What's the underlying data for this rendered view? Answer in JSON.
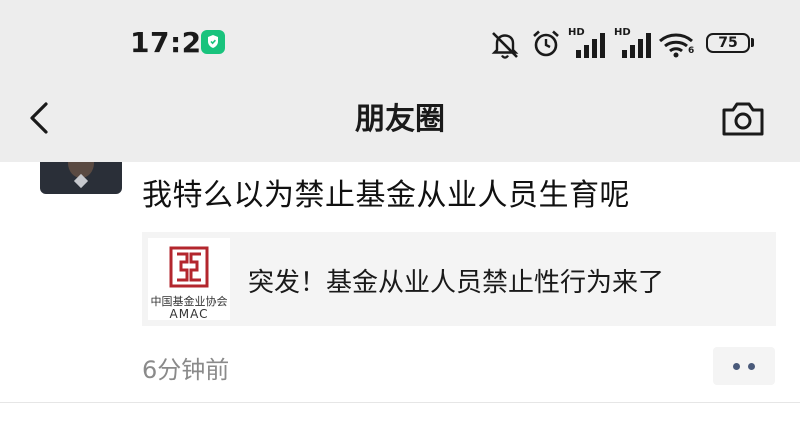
{
  "status_bar": {
    "time": "17:21",
    "battery": "75",
    "signal_label_1": "HD",
    "signal_label_2": "HD",
    "wifi_label": "6"
  },
  "nav": {
    "title": "朋友圈"
  },
  "post": {
    "text": "我特么以为禁止基金从业人员生育呢",
    "link": {
      "title": "突发！基金从业人员禁止性行为来了",
      "thumb_cn": "中国基金业协会",
      "thumb_en": "AMAC"
    },
    "time_ago": "6分钟前"
  },
  "colors": {
    "header_bg": "#ededed",
    "accent_green": "#19c37d",
    "logo_red": "#b3262d",
    "more_dots": "#4a5a7a"
  }
}
